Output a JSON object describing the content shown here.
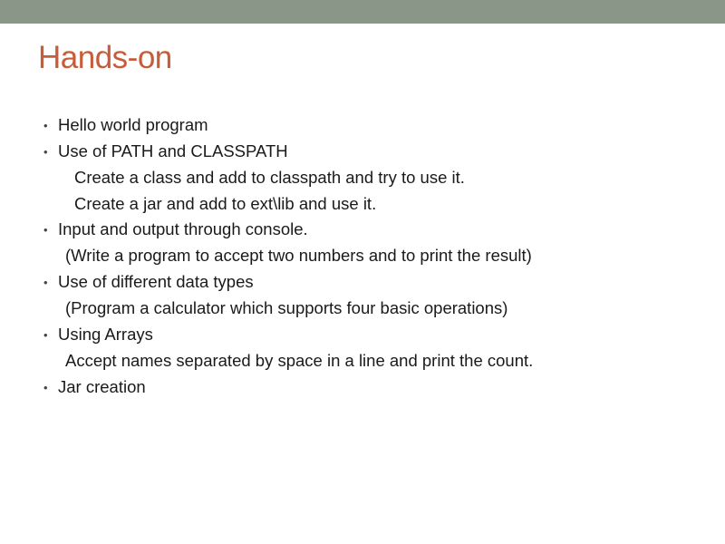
{
  "title": "Hands-on",
  "items": [
    {
      "text": "Hello world program",
      "sublines": []
    },
    {
      "text": "Use of PATH and CLASSPATH",
      "sublines": [
        "Create a class and add to classpath and try to use it.",
        "Create a jar and add to ext\\lib and use it."
      ]
    },
    {
      "text": "Input and output through console.",
      "sublines": [
        "(Write a program to accept two numbers and to print the result)"
      ],
      "tight": true
    },
    {
      "text": "Use of different data types",
      "sublines": [
        "(Program a calculator which supports four basic operations)"
      ],
      "tight": true
    },
    {
      "text": "Using Arrays",
      "sublines": [
        "Accept  names separated by space in a line and print the count."
      ],
      "tight": true
    },
    {
      "text": "Jar creation",
      "sublines": []
    }
  ]
}
